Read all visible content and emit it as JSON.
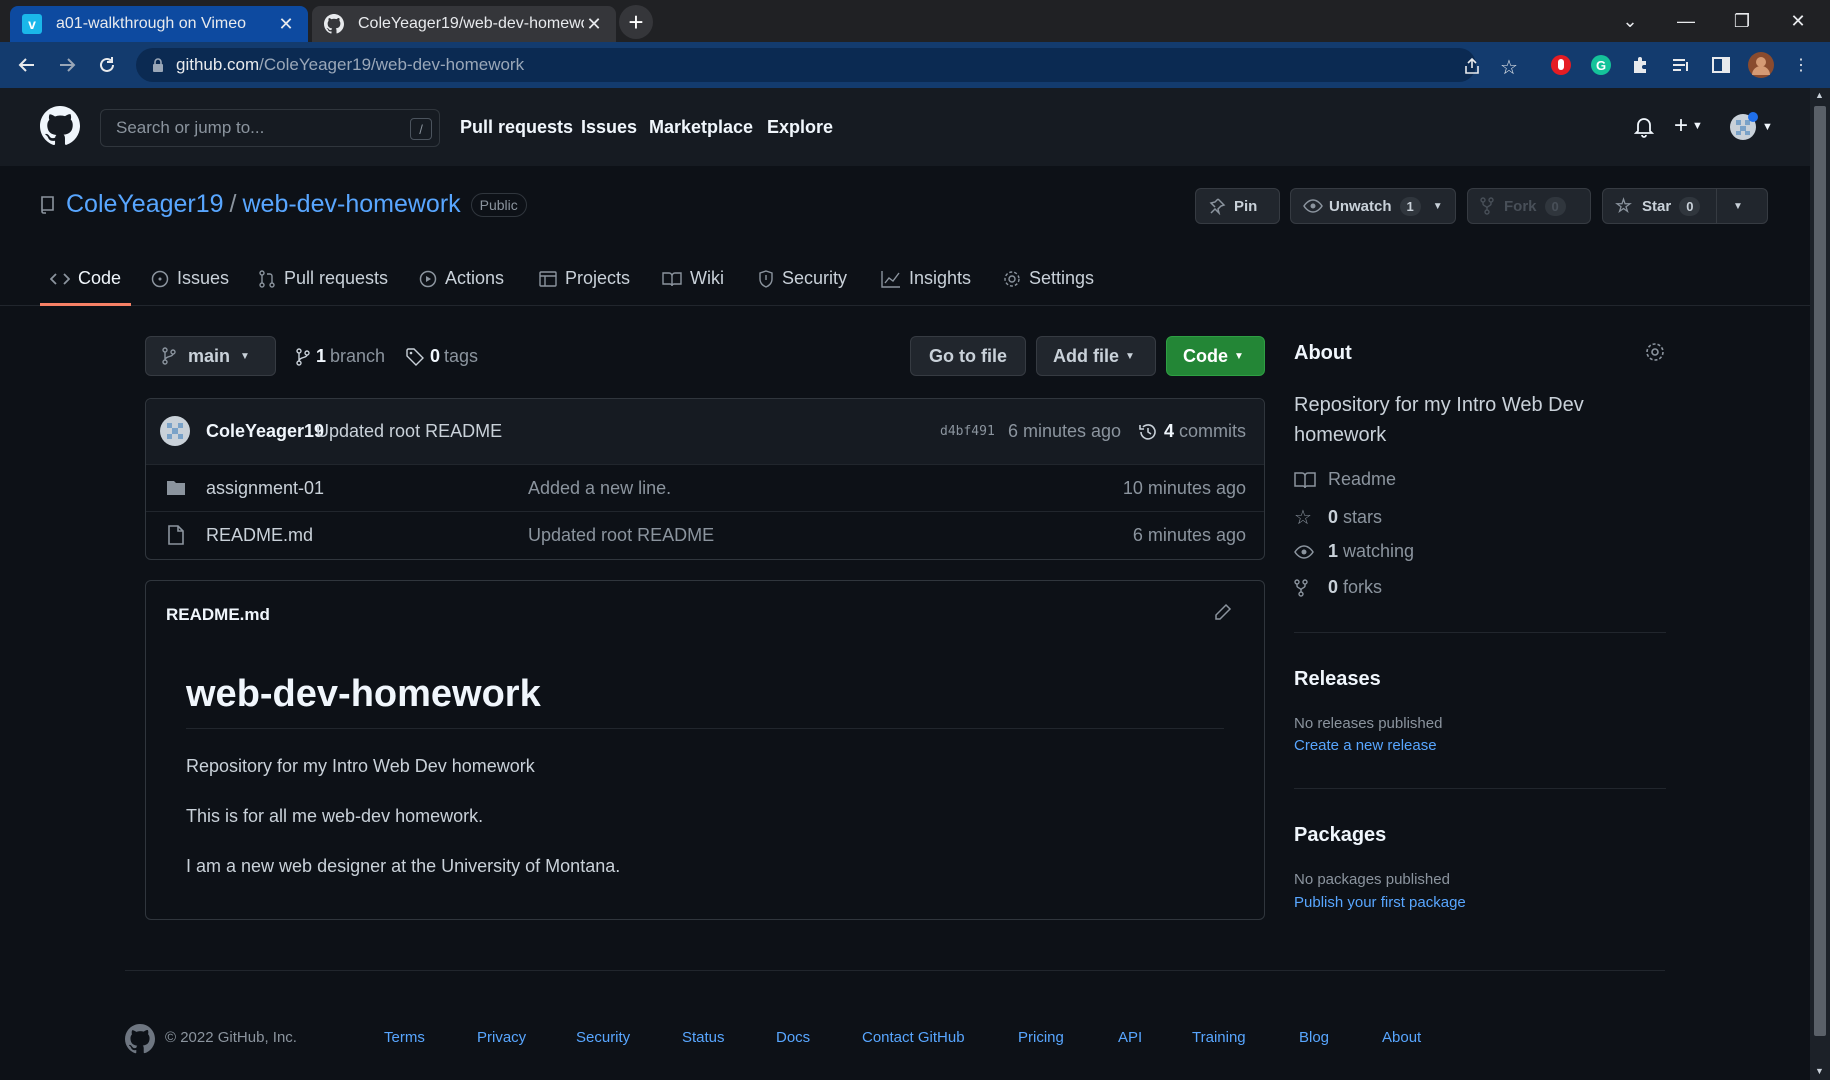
{
  "browser": {
    "tabs": [
      {
        "title": "a01-walkthrough on Vimeo",
        "favicon": "vimeo-icon",
        "active": false
      },
      {
        "title": "ColeYeager19/web-dev-homewo",
        "favicon": "github-icon",
        "active": true
      }
    ],
    "url_host": "github.com",
    "url_path": "/ColeYeager19/web-dev-homework"
  },
  "header": {
    "search_placeholder": "Search or jump to...",
    "search_shortcut": "/",
    "nav": [
      "Pull requests",
      "Issues",
      "Marketplace",
      "Explore"
    ]
  },
  "repo": {
    "owner": "ColeYeager19",
    "separator": "/",
    "name": "web-dev-homework",
    "visibility": "Public",
    "pin_label": "Pin",
    "unwatch_label": "Unwatch",
    "watch_count": "1",
    "fork_label": "Fork",
    "fork_count": "0",
    "star_label": "Star",
    "star_count": "0",
    "tabs": [
      "Code",
      "Issues",
      "Pull requests",
      "Actions",
      "Projects",
      "Wiki",
      "Security",
      "Insights",
      "Settings"
    ]
  },
  "branch_bar": {
    "branch": "main",
    "branch_count": "1",
    "branch_label": "branch",
    "tag_count": "0",
    "tag_label": "tags",
    "go_to_file": "Go to file",
    "add_file": "Add file",
    "code": "Code"
  },
  "latest_commit": {
    "author": "ColeYeager19",
    "message": "Updated root README",
    "sha": "d4bf491",
    "time": "6 minutes ago",
    "commit_count": "4",
    "commit_label": "commits"
  },
  "files": [
    {
      "name": "assignment-01",
      "type": "folder",
      "message": "Added a new line.",
      "time": "10 minutes ago"
    },
    {
      "name": "README.md",
      "type": "file",
      "message": "Updated root README",
      "time": "6 minutes ago"
    }
  ],
  "readme": {
    "filename": "README.md",
    "heading": "web-dev-homework",
    "paragraphs": [
      "Repository for my Intro Web Dev homework",
      "This is for all me web-dev homework.",
      "I am a new web designer at the University of Montana."
    ]
  },
  "about": {
    "title": "About",
    "description": "Repository for my Intro Web Dev homework",
    "readme": "Readme",
    "stars_count": "0",
    "stars_label": "stars",
    "watching_count": "1",
    "watching_label": "watching",
    "forks_count": "0",
    "forks_label": "forks"
  },
  "releases": {
    "title": "Releases",
    "empty": "No releases published",
    "link": "Create a new release"
  },
  "packages": {
    "title": "Packages",
    "empty": "No packages published",
    "link": "Publish your first package"
  },
  "footer": {
    "copyright": "© 2022 GitHub, Inc.",
    "links": [
      "Terms",
      "Privacy",
      "Security",
      "Status",
      "Docs",
      "Contact GitHub",
      "Pricing",
      "API",
      "Training",
      "Blog",
      "About"
    ]
  },
  "colors": {
    "accent_link": "#58a6ff",
    "code_button": "#238636",
    "active_tab_underline": "#f78166",
    "background": "#0d1117"
  }
}
